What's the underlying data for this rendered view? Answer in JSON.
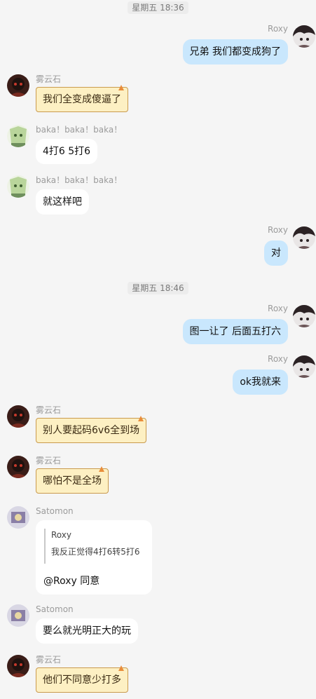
{
  "timestamps": [
    "星期五 18:36",
    "星期五 18:46"
  ],
  "users": {
    "roxy": "Roxy",
    "wuyunshi": "雾云石",
    "baka": "baka！baka！baka！",
    "satomon": "Satomon"
  },
  "messages": [
    "兄弟 我们都变成狗了",
    "我们全变成傻逼了",
    "4打6  5打6",
    "就这样吧",
    "对",
    "图一让了 后面五打六",
    "ok我就来",
    "别人要起码6v6全到场",
    "哪怕不是全场",
    "要么就光明正大的玩",
    "他们不同意少打多"
  ],
  "quote": {
    "name": "Roxy",
    "text": "我反正觉得4打6转5打6",
    "reply": "@Roxy 同意"
  },
  "colors": {
    "background": "#f5f5f5",
    "self_bubble": "#c9e7fd",
    "other_bubble": "#ffffff",
    "scroll_bubble": "#fdf0c3"
  }
}
